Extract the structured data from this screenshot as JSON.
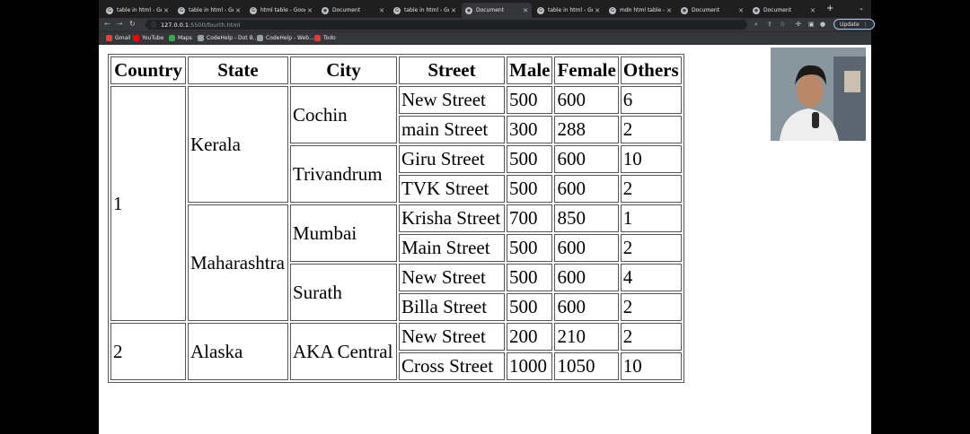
{
  "browser": {
    "tabs": [
      {
        "title": "table in html - Goog",
        "active": false
      },
      {
        "title": "table in html - Goog",
        "active": false
      },
      {
        "title": "html table - Googl",
        "active": false
      },
      {
        "title": "Document",
        "active": false
      },
      {
        "title": "table in html - Goog",
        "active": false
      },
      {
        "title": "Document",
        "active": true
      },
      {
        "title": "table in html - Goog",
        "active": false
      },
      {
        "title": "mdn html table - Go",
        "active": false
      },
      {
        "title": "Document",
        "active": false
      },
      {
        "title": "Document",
        "active": false
      }
    ],
    "url_host": "127.0.0.1",
    "url_path": ":5500/fourth.html",
    "update_label": "Update",
    "bookmarks": [
      {
        "label": "Gmail",
        "color": "#ea4335"
      },
      {
        "label": "YouTube",
        "color": "#ff0000"
      },
      {
        "label": "Maps",
        "color": "#34a853"
      },
      {
        "label": "CodeHelp - Dot B...",
        "color": "#9aa0a6"
      },
      {
        "label": "CodeHelp - Web...",
        "color": "#9aa0a6"
      },
      {
        "label": "Todo",
        "color": "#e53935"
      }
    ]
  },
  "table": {
    "headers": [
      "Country",
      "State",
      "City",
      "Street",
      "Male",
      "Female",
      "Others"
    ],
    "country_1": "1",
    "country_2": "2",
    "state_kerala": "Kerala",
    "state_maharashtra": "Maharashtra",
    "state_alaska": "Alaska",
    "city_cochin": "Cochin",
    "city_trivandrum": "Trivandrum",
    "city_mumbai": "Mumbai",
    "city_surath": "Surath",
    "city_aka": "AKA Central",
    "rows": [
      {
        "street": "New Street",
        "male": "500",
        "female": "600",
        "others": "6"
      },
      {
        "street": "main Street",
        "male": "300",
        "female": "288",
        "others": "2"
      },
      {
        "street": "Giru Street",
        "male": "500",
        "female": "600",
        "others": "10"
      },
      {
        "street": "TVK Street",
        "male": "500",
        "female": "600",
        "others": "2"
      },
      {
        "street": "Krisha Street",
        "male": "700",
        "female": "850",
        "others": "1"
      },
      {
        "street": "Main Street",
        "male": "500",
        "female": "600",
        "others": "2"
      },
      {
        "street": "New Street",
        "male": "500",
        "female": "600",
        "others": "4"
      },
      {
        "street": "Billa Street",
        "male": "500",
        "female": "600",
        "others": "2"
      },
      {
        "street": "New Street",
        "male": "200",
        "female": "210",
        "others": "2"
      },
      {
        "street": "Cross Street",
        "male": "1000",
        "female": "1050",
        "others": "10"
      }
    ]
  }
}
